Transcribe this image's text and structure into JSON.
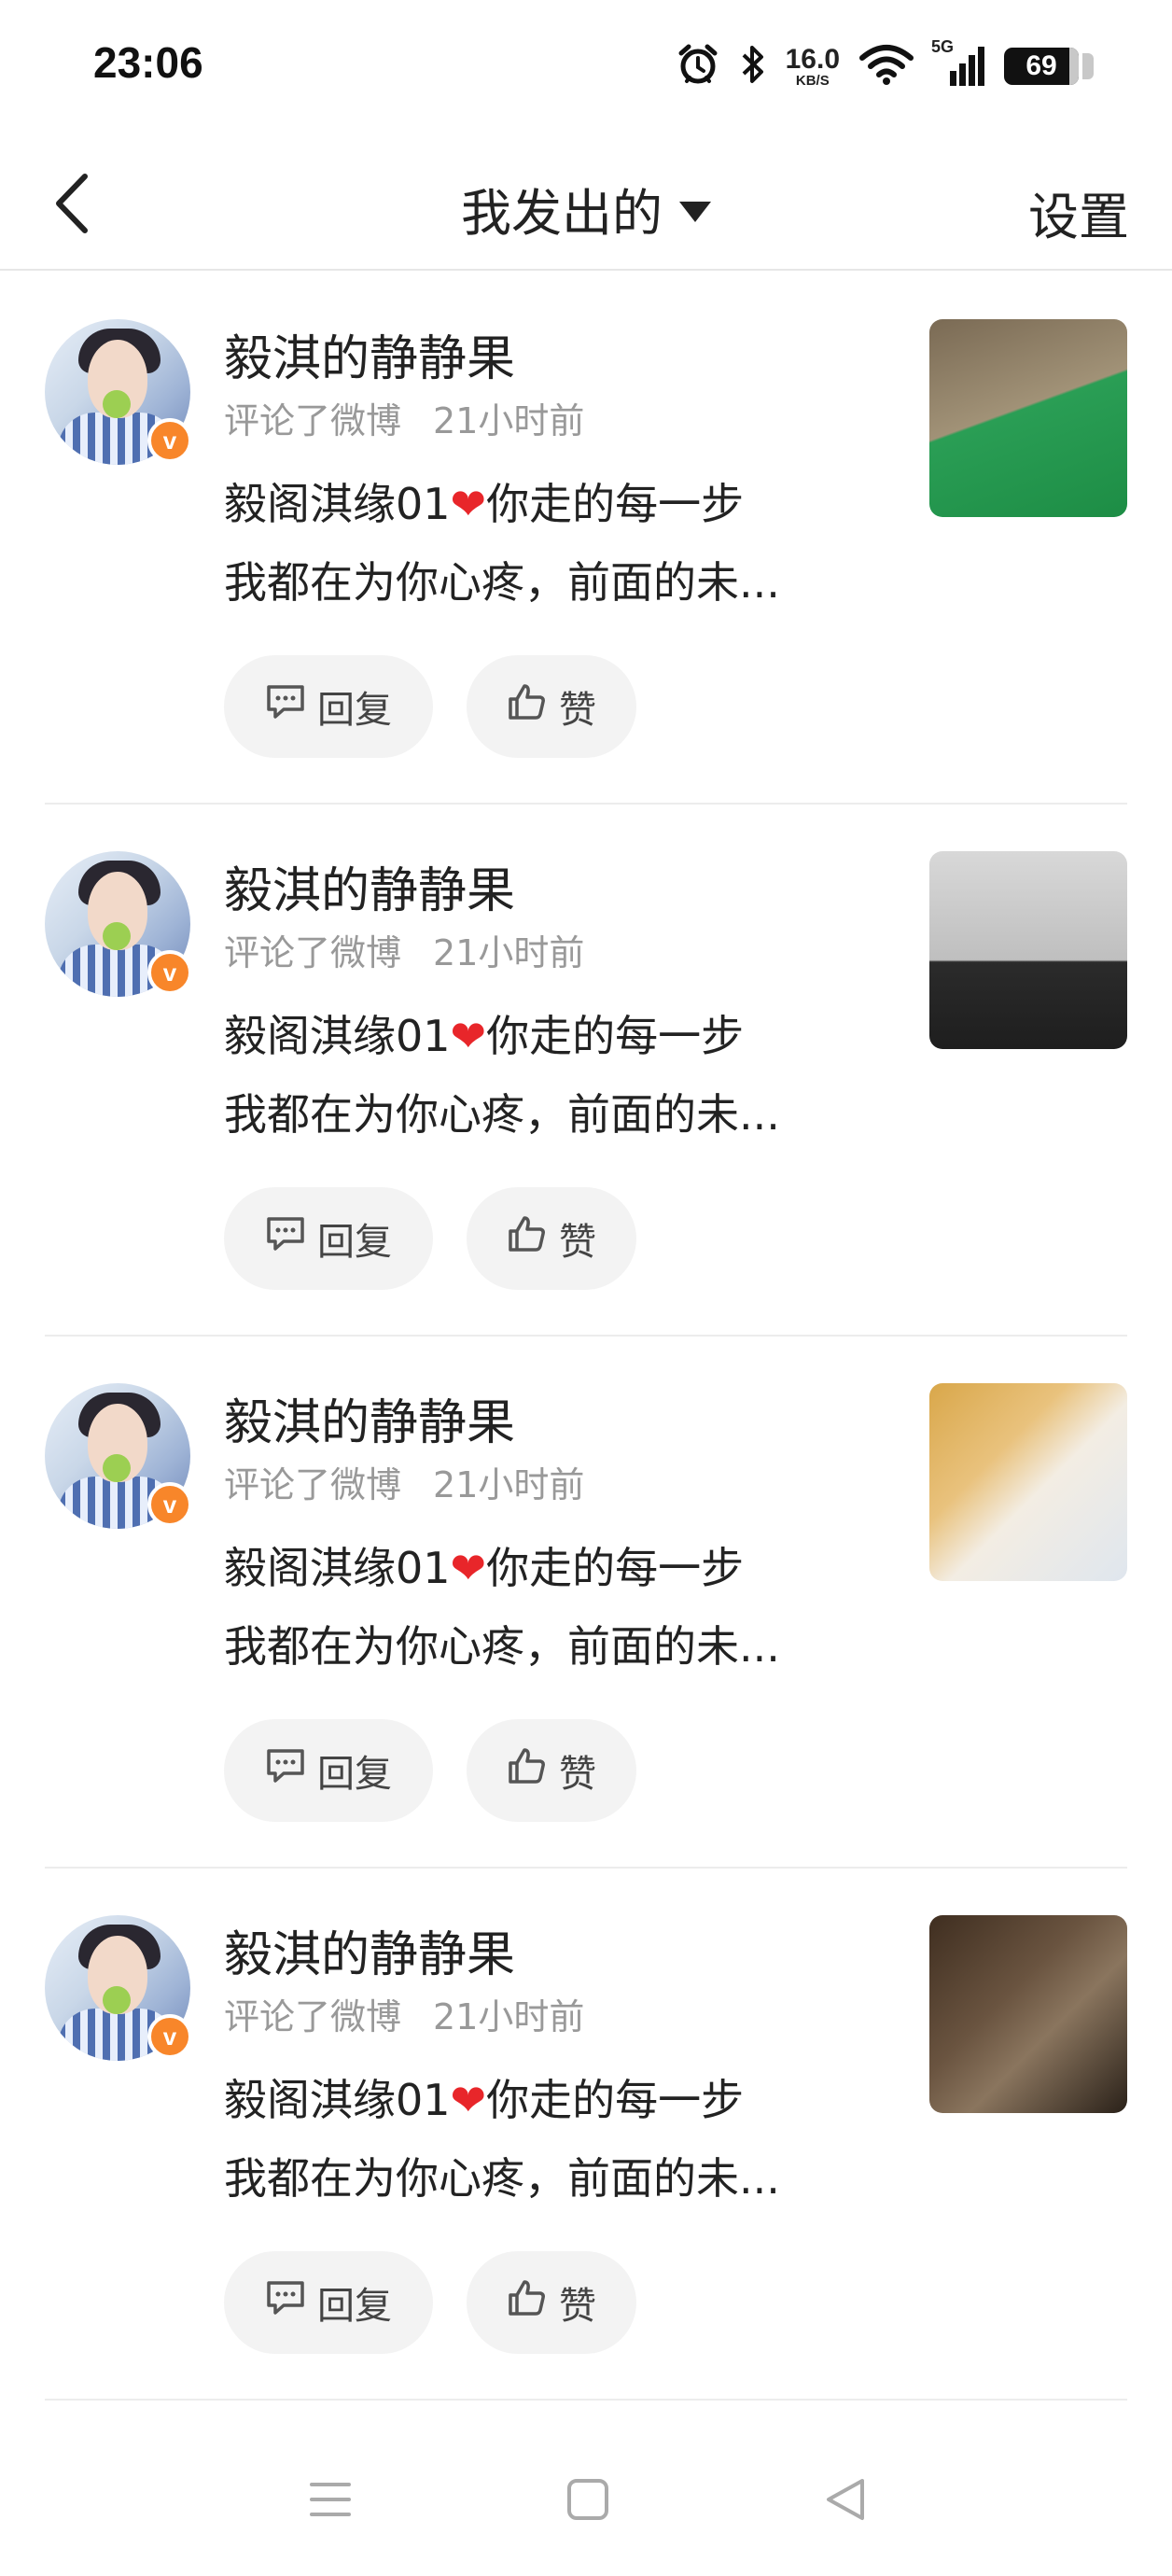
{
  "status_bar": {
    "time": "23:06",
    "network_speed": "16.0",
    "network_speed_unit": "KB/S",
    "network_type": "5G",
    "battery": "69"
  },
  "nav": {
    "title": "我发出的",
    "settings_label": "设置"
  },
  "feed": [
    {
      "username": "毅淇的静静果",
      "action": "评论了微博",
      "time": "21小时前",
      "line1_prefix": "毅阁淇缘01",
      "heart": "❤",
      "line1_suffix": "你走的每一步",
      "line2": "我都在为你心疼，前面的未...",
      "verified_badge": "v",
      "reply_label": "回复",
      "like_label": "赞"
    },
    {
      "username": "毅淇的静静果",
      "action": "评论了微博",
      "time": "21小时前",
      "line1_prefix": "毅阁淇缘01",
      "heart": "❤",
      "line1_suffix": "你走的每一步",
      "line2": "我都在为你心疼，前面的未...",
      "verified_badge": "v",
      "reply_label": "回复",
      "like_label": "赞"
    },
    {
      "username": "毅淇的静静果",
      "action": "评论了微博",
      "time": "21小时前",
      "line1_prefix": "毅阁淇缘01",
      "heart": "❤",
      "line1_suffix": "你走的每一步",
      "line2": "我都在为你心疼，前面的未...",
      "verified_badge": "v",
      "reply_label": "回复",
      "like_label": "赞"
    },
    {
      "username": "毅淇的静静果",
      "action": "评论了微博",
      "time": "21小时前",
      "line1_prefix": "毅阁淇缘01",
      "heart": "❤",
      "line1_suffix": "你走的每一步",
      "line2": "我都在为你心疼，前面的未...",
      "verified_badge": "v",
      "reply_label": "回复",
      "like_label": "赞"
    }
  ],
  "colors": {
    "verified_badge": "#f8862a",
    "heart": "#e8262a",
    "meta_text": "#999999",
    "pill_background": "#f3f3f3"
  },
  "icons": {
    "back": "chevron-left-icon",
    "dropdown": "caret-down-icon",
    "reply": "comment-icon",
    "like": "thumbs-up-icon",
    "alarm": "alarm-icon",
    "bluetooth": "bluetooth-icon",
    "wifi": "wifi-icon",
    "signal": "signal-icon",
    "battery": "battery-icon",
    "sys_menu": "menu-icon",
    "sys_home": "home-icon",
    "sys_back": "back-triangle-icon"
  }
}
